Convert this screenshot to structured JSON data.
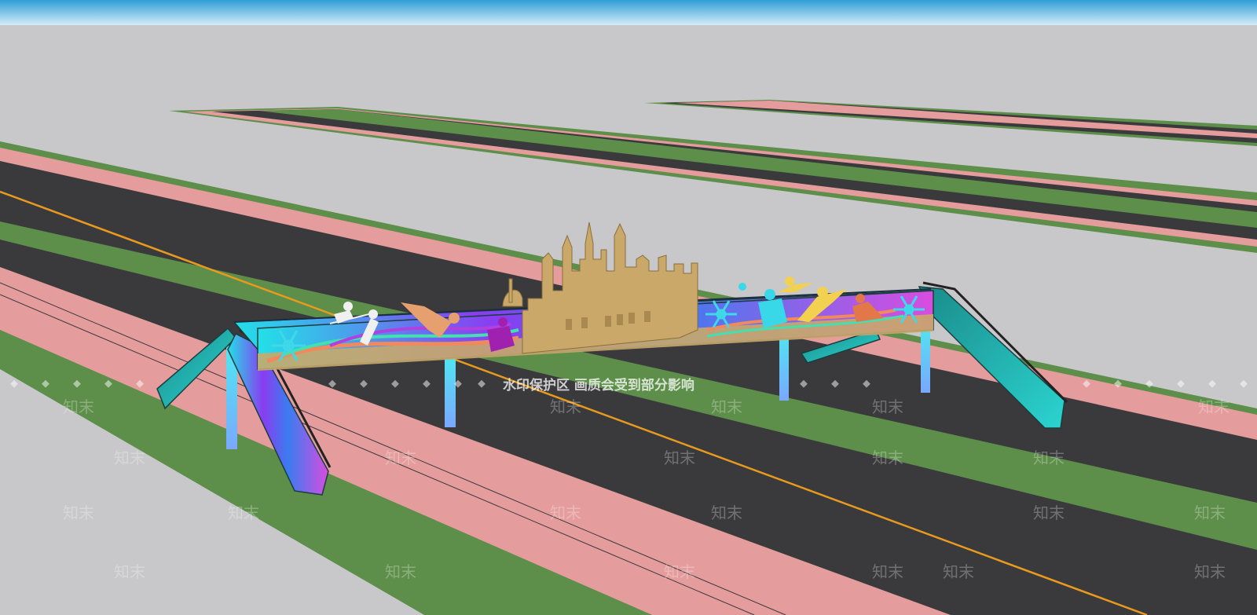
{
  "scene": {
    "sky_band_top": "#2f9fd6",
    "sky_band_bottom": "#d4ecf7",
    "ground": "#c8c8cb",
    "asphalt": "#3a3a3d",
    "median": "#5d8f4a",
    "sidewalk": "#e59c9c",
    "lane_line": "#e89a1e",
    "bridge_gradient": [
      "#22e0e8",
      "#8a3cf0",
      "#d94ce0"
    ],
    "skyline_color": "#c9a86a",
    "stair_color": "#2bb6b0"
  },
  "icons": [
    "snowflake-icon",
    "skier-icon",
    "snowboarder-icon",
    "skater-icon"
  ],
  "watermark": {
    "banner": "水印保护区   画质会受到部分影响",
    "brand": "知末"
  }
}
